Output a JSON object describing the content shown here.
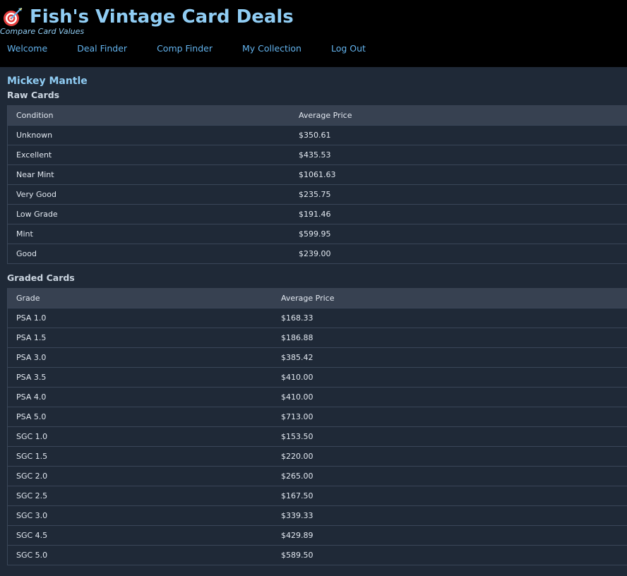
{
  "header": {
    "title": "Fish's Vintage Card Deals",
    "tagline": "Compare Card Values",
    "logo_icon": "dartboard-icon"
  },
  "nav": [
    {
      "label": "Welcome"
    },
    {
      "label": "Deal Finder"
    },
    {
      "label": "Comp Finder"
    },
    {
      "label": "My Collection"
    },
    {
      "label": "Log Out"
    }
  ],
  "player": {
    "name": "Mickey Mantle"
  },
  "raw": {
    "title": "Raw Cards",
    "headers": [
      "Condition",
      "Average Price"
    ],
    "rows": [
      [
        "Unknown",
        "$350.61"
      ],
      [
        "Excellent",
        "$435.53"
      ],
      [
        "Near Mint",
        "$1061.63"
      ],
      [
        "Very Good",
        "$235.75"
      ],
      [
        "Low Grade",
        "$191.46"
      ],
      [
        "Mint",
        "$599.95"
      ],
      [
        "Good",
        "$239.00"
      ]
    ]
  },
  "graded": {
    "title": "Graded Cards",
    "headers": [
      "Grade",
      "Average Price"
    ],
    "rows": [
      [
        "PSA 1.0",
        "$168.33"
      ],
      [
        "PSA 1.5",
        "$186.88"
      ],
      [
        "PSA 3.0",
        "$385.42"
      ],
      [
        "PSA 3.5",
        "$410.00"
      ],
      [
        "PSA 4.0",
        "$410.00"
      ],
      [
        "PSA 5.0",
        "$713.00"
      ],
      [
        "SGC 1.0",
        "$153.50"
      ],
      [
        "SGC 1.5",
        "$220.00"
      ],
      [
        "SGC 2.0",
        "$265.00"
      ],
      [
        "SGC 2.5",
        "$167.50"
      ],
      [
        "SGC 3.0",
        "$339.33"
      ],
      [
        "SGC 4.5",
        "$429.89"
      ],
      [
        "SGC 5.0",
        "$589.50"
      ]
    ]
  },
  "colors": {
    "header_bg": "#000000",
    "page_bg": "#1f2937",
    "title": "#90cdf4",
    "link": "#63b3ed",
    "table_header_bg": "#374151"
  }
}
